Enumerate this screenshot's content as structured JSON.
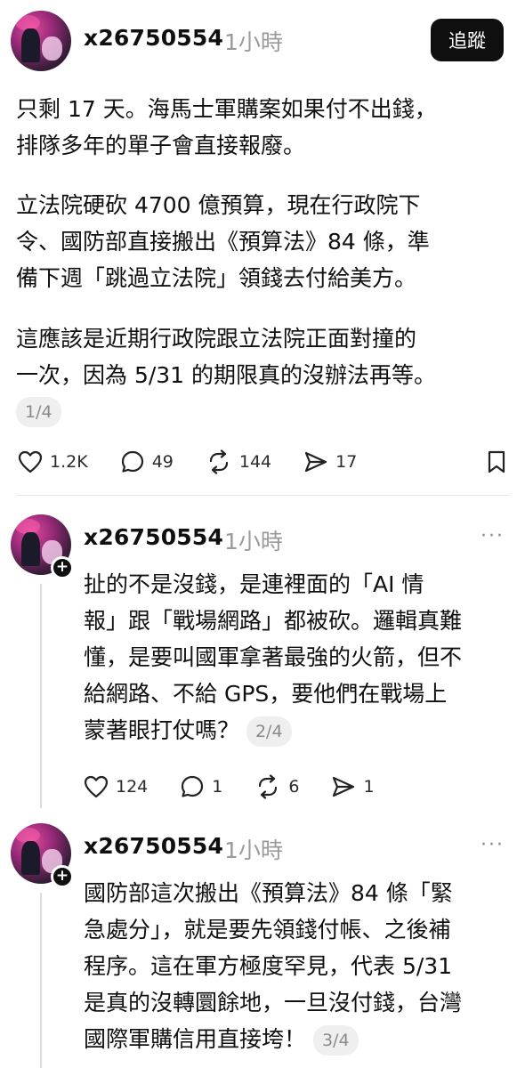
{
  "follow_label": "追蹤",
  "post": {
    "username": "x26750554",
    "time": "1小時",
    "paragraphs": [
      [
        "只剩 17 天。海馬士軍購案如果付不出錢，",
        "排隊多年的單子會直接報廢。"
      ],
      [
        "立法院硬砍 4700 億預算，現在行政院下",
        "令、國防部直接搬出《預算法》84 條，準",
        "備下週「跳過立法院」領錢去付給美方。"
      ],
      [
        "這應該是近期行政院跟立法院正面對撞的",
        "一次，因為 5/31 的期限真的沒辦法再等。"
      ]
    ],
    "page_badge": "1/4",
    "likes": "1.2K",
    "comments": "49",
    "reposts": "144",
    "shares": "17"
  },
  "reply1": {
    "username": "x26750554",
    "time": "1小時",
    "lines": [
      "扯的不是沒錢，是連裡面的「AI 情",
      "報」跟「戰場網路」都被砍。邏輯真難",
      "懂，是要叫國軍拿著最強的火箭，但不",
      "給網路、不給 GPS，要他們在戰場上",
      "蒙著眼打仗嗎？"
    ],
    "page_badge": "2/4",
    "likes": "124",
    "comments": "1",
    "reposts": "6",
    "shares": "1"
  },
  "reply2": {
    "username": "x26750554",
    "time": "1小時",
    "lines": [
      "國防部這次搬出《預算法》84 條「緊",
      "急處分」，就是要先領錢付帳、之後補",
      "程序。這在軍方極度罕見，代表 5/31",
      "是真的沒轉圜餘地，一旦沒付錢，台灣",
      "國際軍購信用直接垮！"
    ],
    "page_badge": "3/4"
  },
  "icons": [
    "heart-icon",
    "comment-icon",
    "repost-icon",
    "share-icon",
    "bookmark-icon",
    "more-icon",
    "plus-icon"
  ]
}
